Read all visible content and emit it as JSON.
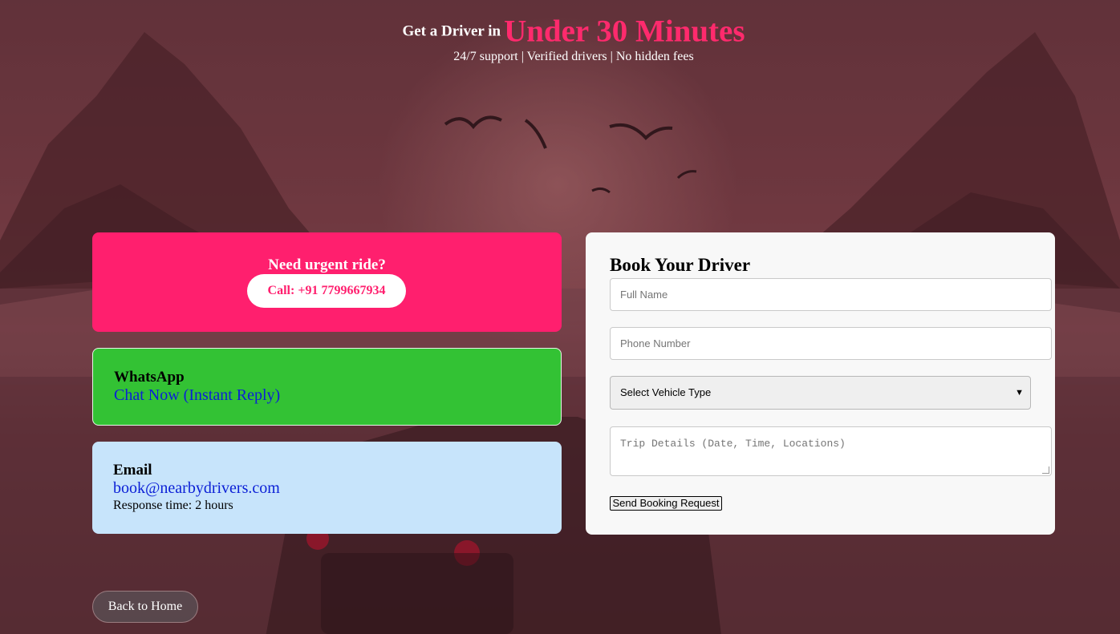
{
  "hero": {
    "prefix": "Get a Driver in",
    "highlight": "Under 30 Minutes",
    "subtitle": "24/7 support | Verified drivers | No hidden fees"
  },
  "urgent": {
    "title": "Need urgent ride?",
    "call_label": "Call: +91 7799667934"
  },
  "whatsapp": {
    "label": "WhatsApp",
    "link": "Chat Now (Instant Reply)"
  },
  "email": {
    "label": "Email",
    "address": "book@nearbydrivers.com",
    "note": "Response time: 2 hours"
  },
  "form": {
    "title": "Book Your Driver",
    "name_placeholder": "Full Name",
    "phone_placeholder": "Phone Number",
    "vehicle_selected": "Select Vehicle Type",
    "trip_placeholder": "Trip Details (Date, Time, Locations)",
    "submit_label": "Send Booking Request"
  },
  "back_label": "Back to Home",
  "colors": {
    "accent": "#ff1f6e",
    "whatsapp": "#33c234",
    "email_bg": "#c7e4fb",
    "link": "#0b1fd6"
  },
  "icons": {
    "select_arrow": "chevron-down-icon"
  }
}
